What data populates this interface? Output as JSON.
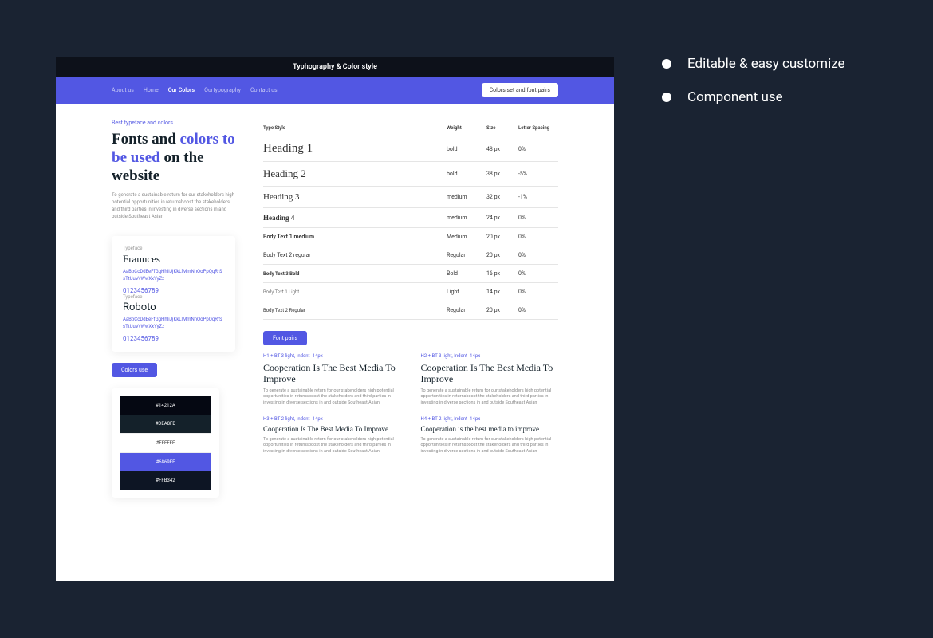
{
  "titlebar": "Typhography & Color style",
  "nav": {
    "items": [
      "About us",
      "Home",
      "Our Colors",
      "Ourtypography",
      "Contact us"
    ],
    "activeIndex": 2,
    "cta": "Colors set and font pairs"
  },
  "hero": {
    "eyebrow": "Best typeface and colors",
    "title_pre": "Fonts and ",
    "title_accent": "colors to be used",
    "title_post": " on the website",
    "desc": "To generate a sustainable return for our stakeholders high potential opportunities in returnsboost the stakeholders and third parties in investing in diverse sections in and outside Southeast Asian"
  },
  "typefaces": {
    "label": "Typeface",
    "font1": "Fraunces",
    "font2": "Roboto",
    "sample1": "AaBbCcDdEeFfGgHhIiJjKkLlMmNnOoPpQqRrSsTtUuVvWwXxYyZz",
    "sample2": "AaBbCcDdEeFfGgHhIiJjKkLlMmNnOoPpQqRrSsTtUuVvWwXxYyZz",
    "nums": "0123456789"
  },
  "buttons": {
    "colors_use": "Colors use",
    "font_pairs": "Font pairs"
  },
  "swatches": [
    "#14212A",
    "#DEA8FD",
    "#FFFFFF",
    "#6869FF",
    "#FFB342"
  ],
  "table": {
    "headers": [
      "Type Style",
      "Weight",
      "Size",
      "Letter Spacing"
    ],
    "rows": [
      {
        "name": "Heading 1",
        "weight": "bold",
        "size": "48 px",
        "ls": "0%",
        "cls": "heading1"
      },
      {
        "name": "Heading 2",
        "weight": "bold",
        "size": "38 px",
        "ls": "-5%",
        "cls": "heading2"
      },
      {
        "name": "Heading 3",
        "weight": "medium",
        "size": "32 px",
        "ls": "-1%",
        "cls": "heading3"
      },
      {
        "name": "Heading 4",
        "weight": "medium",
        "size": "24 px",
        "ls": "0%",
        "cls": "heading4"
      },
      {
        "name": "Body Text 1 medium",
        "weight": "Medium",
        "size": "20 px",
        "ls": "0%",
        "cls": "body1"
      },
      {
        "name": "Body Text 2 regular",
        "weight": "Regular",
        "size": "20 px",
        "ls": "0%",
        "cls": "body2"
      },
      {
        "name": "Body Text 3 Bold",
        "weight": "Bold",
        "size": "16  px",
        "ls": "0%",
        "cls": "body3"
      },
      {
        "name": "Body Text 1 Light",
        "weight": "Light",
        "size": "14 px",
        "ls": "0%",
        "cls": "body4"
      },
      {
        "name": "Body Text 2 Regular",
        "weight": "Regular",
        "size": "20 px",
        "ls": "0%",
        "cls": "body5"
      }
    ]
  },
  "fontpairs": {
    "meta1": "H1 + BT 3 light, Indent -14px",
    "meta2": "H2 + BT 3 light, Indent -14px",
    "meta3": "H3 + BT 2 light, Indent -14px",
    "meta4": "H4 + BT 2 light, Indent -14px",
    "title": "Cooperation Is The Best Media To Improve",
    "title_lc": "Cooperation is the best media to improve",
    "body": "To generate a sustainable return for our stakeholders high potential opportunities in returnsboost the stakeholders and third parties in investing in diverse sections in and outside Southeast Asian"
  },
  "features": [
    "Editable & easy customize",
    "Component use"
  ]
}
